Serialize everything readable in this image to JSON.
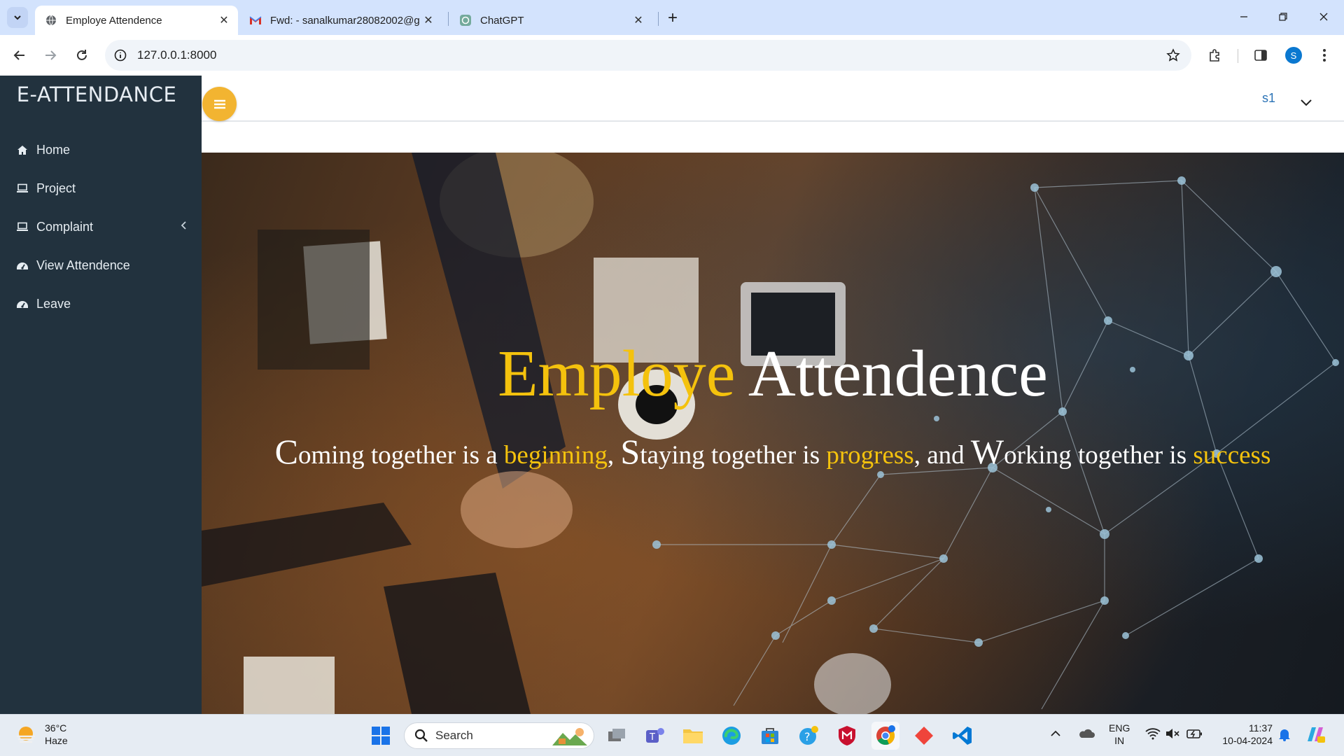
{
  "browser": {
    "tabs": [
      {
        "title": "Employe Attendence",
        "active": true,
        "favicon": "globe-icon"
      },
      {
        "title": "Fwd: - sanalkumar28082002@g",
        "active": false,
        "favicon": "gmail-icon"
      },
      {
        "title": "ChatGPT",
        "active": false,
        "favicon": "chatgpt-icon"
      }
    ],
    "url": "127.0.0.1:8000",
    "profile_initial": "S"
  },
  "sidebar": {
    "brand": "E-ATTENDANCE",
    "items": [
      {
        "label": "Home",
        "icon": "home-icon"
      },
      {
        "label": "Project",
        "icon": "laptop-icon"
      },
      {
        "label": "Complaint",
        "icon": "laptop-icon",
        "has_submenu": true
      },
      {
        "label": "View Attendence",
        "icon": "dashboard-icon"
      },
      {
        "label": "Leave",
        "icon": "dashboard-icon"
      }
    ]
  },
  "topbar": {
    "user": "s1"
  },
  "hero": {
    "title_accent": "Employe",
    "title_rest": "Attendence",
    "sub": {
      "c1": "C",
      "t1": "oming together is a ",
      "g1": "beginning",
      "t2": ", ",
      "c2": "S",
      "t3": "taying together is ",
      "g2": "progress",
      "t4": ", and ",
      "c3": "W",
      "t5": "orking together is ",
      "g3": "success"
    }
  },
  "taskbar": {
    "weather_temp": "36°C",
    "weather_desc": "Haze",
    "search_label": "Search",
    "lang_top": "ENG",
    "lang_bottom": "IN",
    "time": "11:37",
    "date": "10-04-2024"
  },
  "colors": {
    "sidebar_bg": "#22323e",
    "accent_gold": "#f4c20d",
    "fab": "#f2b431",
    "user_link": "#2b73b6"
  }
}
